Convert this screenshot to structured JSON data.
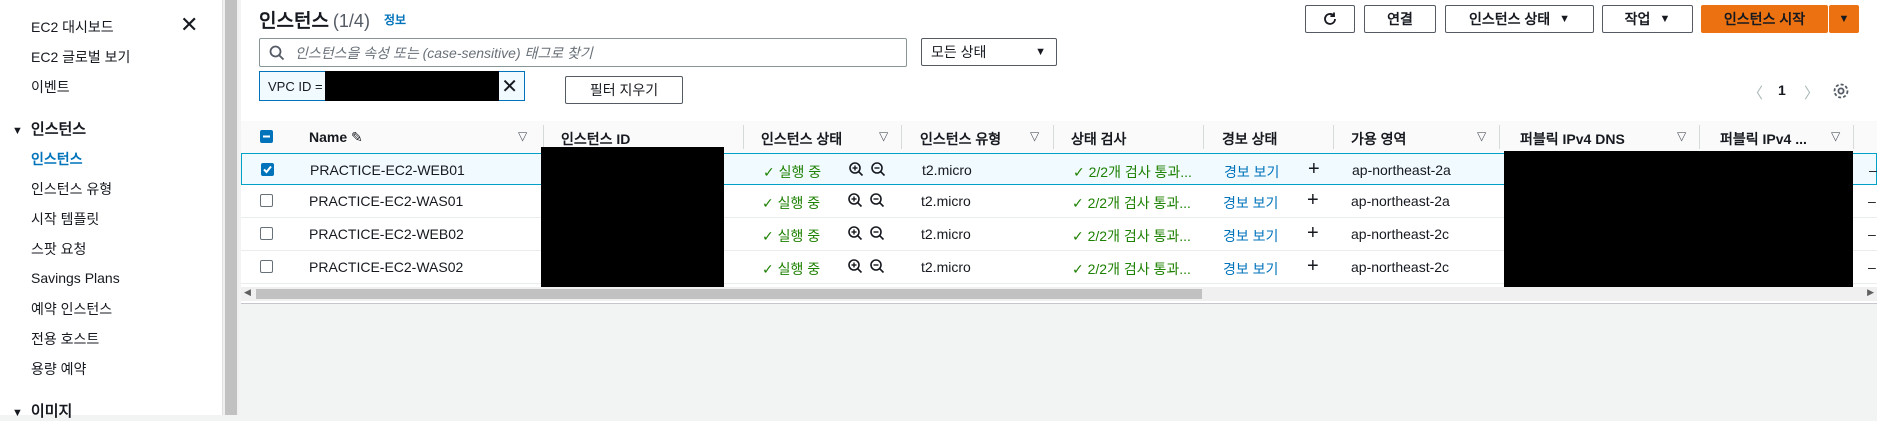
{
  "sidebar": {
    "items_top": [
      "EC2 대시보드",
      "EC2 글로벌 보기",
      "이벤트"
    ],
    "section_instances": "인스턴스",
    "instance_items": [
      "인스턴스",
      "인스턴스 유형",
      "시작 템플릿",
      "스팟 요청",
      "Savings Plans",
      "예약 인스턴스",
      "전용 호스트",
      "용량 예약"
    ],
    "section_images": "이미지"
  },
  "header": {
    "title": "인스턴스",
    "count": "(1/4)",
    "info": "정보"
  },
  "actions": {
    "connect": "연결",
    "instance_state": "인스턴스 상태",
    "actions": "작업",
    "launch": "인스턴스 시작"
  },
  "search": {
    "placeholder": "인스턴스을 속성 또는 (case-sensitive) 태그로 찾기"
  },
  "state_filter": "모든 상태",
  "filter_token": {
    "label": "VPC ID ="
  },
  "clear_filters": "필터 지우기",
  "pagination": {
    "page": "1"
  },
  "table": {
    "columns": [
      "Name",
      "인스턴스 ID",
      "인스턴스 상태",
      "인스턴스 유형",
      "상태 검사",
      "경보 상태",
      "가용 영역",
      "퍼블릭 IPv4 DNS",
      "퍼블릭 IPv4 ..."
    ],
    "rows": [
      {
        "name": "PRACTICE-EC2-WEB01",
        "state": "실행 중",
        "type": "t2.micro",
        "check": "2/2개 검사 통과...",
        "alarm": "경보 보기",
        "az": "ap-northeast-2a",
        "selected": true
      },
      {
        "name": "PRACTICE-EC2-WAS01",
        "state": "실행 중",
        "type": "t2.micro",
        "check": "2/2개 검사 통과...",
        "alarm": "경보 보기",
        "az": "ap-northeast-2a",
        "selected": false
      },
      {
        "name": "PRACTICE-EC2-WEB02",
        "state": "실행 중",
        "type": "t2.micro",
        "check": "2/2개 검사 통과...",
        "alarm": "경보 보기",
        "az": "ap-northeast-2c",
        "selected": false
      },
      {
        "name": "PRACTICE-EC2-WAS02",
        "state": "실행 중",
        "type": "t2.micro",
        "check": "2/2개 검사 통과...",
        "alarm": "경보 보기",
        "az": "ap-northeast-2c",
        "selected": false
      }
    ],
    "trailing_cell": "–"
  },
  "colors": {
    "accent": "#0073bb",
    "primary_button": "#ec7211",
    "running": "#1d8102"
  }
}
